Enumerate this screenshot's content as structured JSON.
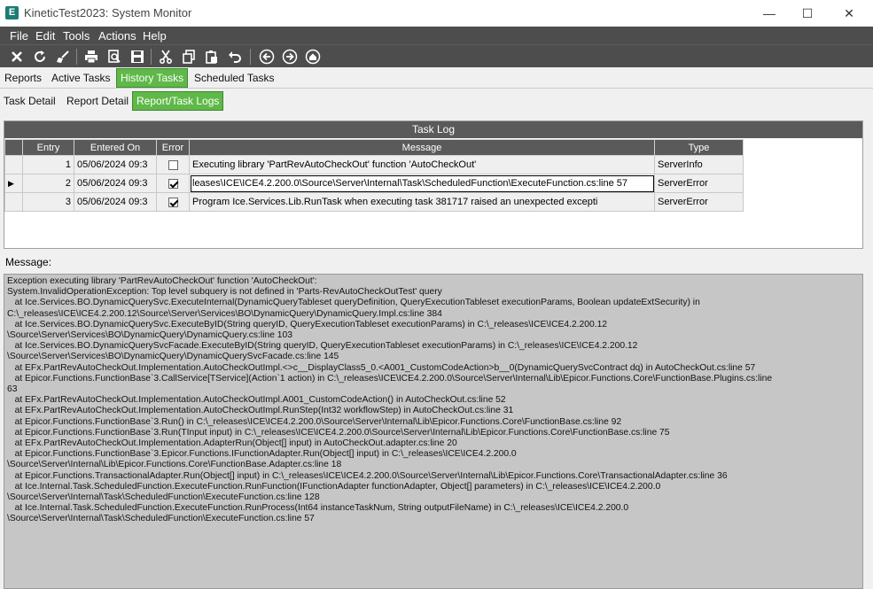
{
  "window": {
    "title": "KineticTest2023: System Monitor",
    "app_icon_letter": "E",
    "minimize": "—",
    "maximize": "☐",
    "close": "✕"
  },
  "menu": [
    "File",
    "Edit",
    "Tools",
    "Actions",
    "Help"
  ],
  "toolbar": {
    "icons": [
      "close-icon",
      "refresh-icon",
      "clear-icon",
      "print-icon",
      "print-preview-icon",
      "save-icon",
      "cut-icon",
      "copy-icon",
      "paste-icon",
      "undo-icon",
      "back-icon",
      "forward-icon",
      "home-icon"
    ]
  },
  "tabs_top": [
    {
      "label": "Reports",
      "active": false
    },
    {
      "label": "Active Tasks",
      "active": false
    },
    {
      "label": "History Tasks",
      "active": true
    },
    {
      "label": "Scheduled Tasks",
      "active": false
    }
  ],
  "tabs_sub": [
    {
      "label": "Task Detail",
      "active": false
    },
    {
      "label": "Report Detail",
      "active": false
    },
    {
      "label": "Report/Task Logs",
      "active": true
    }
  ],
  "task_log": {
    "title": "Task Log",
    "columns": [
      "Entry",
      "Entered On",
      "Error",
      "Message",
      "Type"
    ],
    "rows": [
      {
        "entry": "1",
        "entered_on": "05/06/2024 09:3",
        "error": false,
        "message": "Executing library 'PartRevAutoCheckOut' function 'AutoCheckOut'",
        "type": "ServerInfo",
        "current": false
      },
      {
        "entry": "2",
        "entered_on": "05/06/2024 09:3",
        "error": true,
        "message": "leases\\ICE\\ICE4.2.200.0\\Source\\Server\\Internal\\Task\\ScheduledFunction\\ExecuteFunction.cs:line 57",
        "type": "ServerError",
        "current": true
      },
      {
        "entry": "3",
        "entered_on": "05/06/2024 09:3",
        "error": true,
        "message": "Program Ice.Services.Lib.RunTask when executing task 381717 raised an unexpected excepti",
        "type": "ServerError",
        "current": false
      }
    ]
  },
  "message": {
    "label": "Message:",
    "text": "Exception executing library 'PartRevAutoCheckOut' function 'AutoCheckOut':\nSystem.InvalidOperationException: Top level subquery is not defined in 'Parts-RevAutoCheckOutTest' query\n   at Ice.Services.BO.DynamicQuerySvc.ExecuteInternal(DynamicQueryTableset queryDefinition, QueryExecutionTableset executionParams, Boolean updateExtSecurity) in\nC:\\_releases\\ICE\\ICE4.2.200.12\\Source\\Server\\Services\\BO\\DynamicQuery\\DynamicQuery.Impl.cs:line 384\n   at Ice.Services.BO.DynamicQuerySvc.ExecuteByID(String queryID, QueryExecutionTableset executionParams) in C:\\_releases\\ICE\\ICE4.2.200.12\n\\Source\\Server\\Services\\BO\\DynamicQuery\\DynamicQuery.cs:line 103\n   at Ice.Services.BO.DynamicQuerySvcFacade.ExecuteByID(String queryID, QueryExecutionTableset executionParams) in C:\\_releases\\ICE\\ICE4.2.200.12\n\\Source\\Server\\Services\\BO\\DynamicQuery\\DynamicQuerySvcFacade.cs:line 145\n   at EFx.PartRevAutoCheckOut.Implementation.AutoCheckOutImpl.<>c__DisplayClass5_0.<A001_CustomCodeAction>b__0(DynamicQuerySvcContract dq) in AutoCheckOut.cs:line 57\n   at Epicor.Functions.FunctionBase`3.CallService[TService](Action`1 action) in C:\\_releases\\ICE\\ICE4.2.200.0\\Source\\Server\\Internal\\Lib\\Epicor.Functions.Core\\FunctionBase.Plugins.cs:line\n63\n   at EFx.PartRevAutoCheckOut.Implementation.AutoCheckOutImpl.A001_CustomCodeAction() in AutoCheckOut.cs:line 52\n   at EFx.PartRevAutoCheckOut.Implementation.AutoCheckOutImpl.RunStep(Int32 workflowStep) in AutoCheckOut.cs:line 31\n   at Epicor.Functions.FunctionBase`3.Run() in C:\\_releases\\ICE\\ICE4.2.200.0\\Source\\Server\\Internal\\Lib\\Epicor.Functions.Core\\FunctionBase.cs:line 92\n   at Epicor.Functions.FunctionBase`3.Run(TInput input) in C:\\_releases\\ICE\\ICE4.2.200.0\\Source\\Server\\Internal\\Lib\\Epicor.Functions.Core\\FunctionBase.cs:line 75\n   at EFx.PartRevAutoCheckOut.Implementation.AdapterRun(Object[] input) in AutoCheckOut.adapter.cs:line 20\n   at Epicor.Functions.FunctionBase`3.Epicor.Functions.IFunctionAdapter.Run(Object[] input) in C:\\_releases\\ICE\\ICE4.2.200.0\n\\Source\\Server\\Internal\\Lib\\Epicor.Functions.Core\\FunctionBase.Adapter.cs:line 18\n   at Epicor.Functions.TransactionalAdapter.Run(Object[] input) in C:\\_releases\\ICE\\ICE4.2.200.0\\Source\\Server\\Internal\\Lib\\Epicor.Functions.Core\\TransactionalAdapter.cs:line 36\n   at Ice.Internal.Task.ScheduledFunction.ExecuteFunction.RunFunction(IFunctionAdapter functionAdapter, Object[] parameters) in C:\\_releases\\ICE\\ICE4.2.200.0\n\\Source\\Server\\Internal\\Task\\ScheduledFunction\\ExecuteFunction.cs:line 128\n   at Ice.Internal.Task.ScheduledFunction.ExecuteFunction.RunProcess(Int64 instanceTaskNum, String outputFileName) in C:\\_releases\\ICE\\ICE4.2.200.0\n\\Source\\Server\\Internal\\Task\\ScheduledFunction\\ExecuteFunction.cs:line 57"
  }
}
